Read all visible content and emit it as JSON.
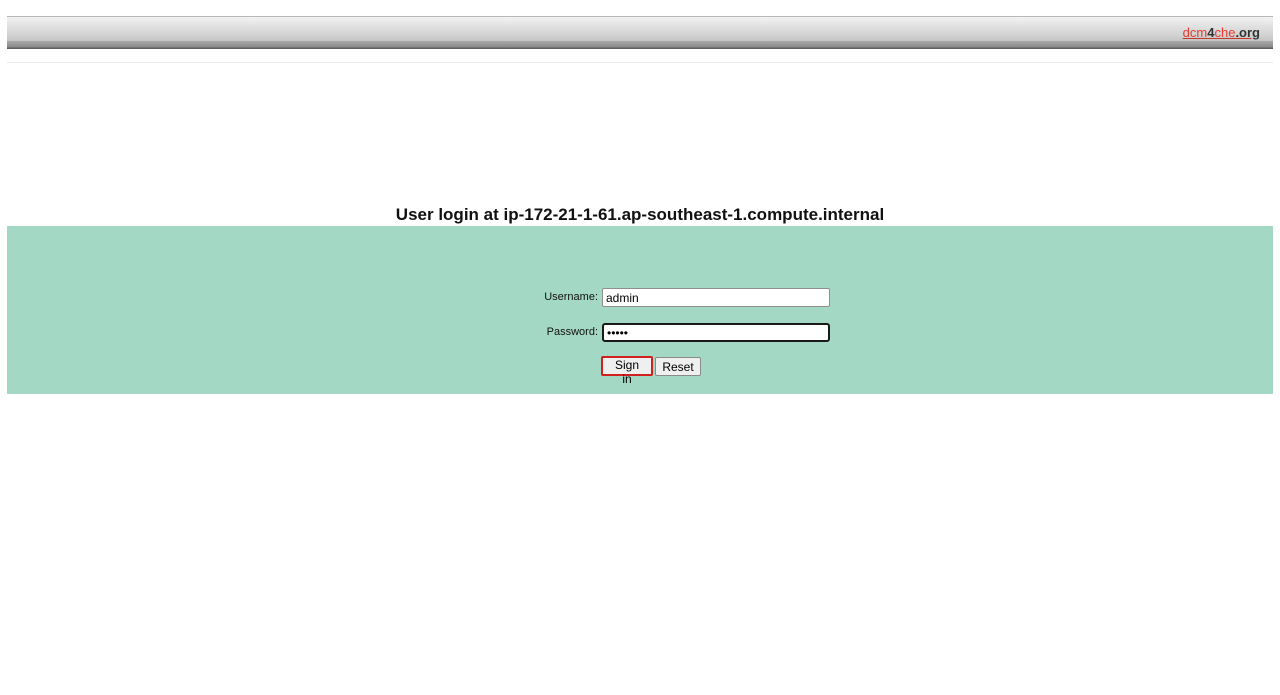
{
  "header": {
    "brand": {
      "part1": "dcm",
      "part2": "4",
      "part3": "che",
      "part4": ".org"
    }
  },
  "login": {
    "title": "User login at ip-172-21-1-61.ap-southeast-1.compute.internal",
    "username_label": "Username:",
    "username_value": "admin",
    "password_label": "Password:",
    "password_value": "admin",
    "sign_in_label": "Sign in",
    "reset_label": "Reset"
  },
  "colors": {
    "panel_background": "#a3d9c4",
    "brand_accent": "#e83a2e",
    "active_button_border": "#d21f1f"
  }
}
